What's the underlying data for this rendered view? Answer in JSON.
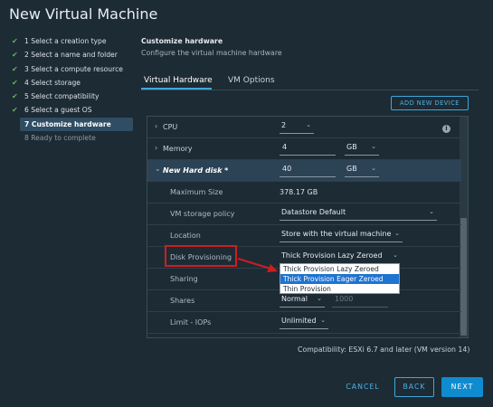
{
  "window": {
    "title": "New Virtual Machine"
  },
  "steps": [
    {
      "label": "1 Select a creation type",
      "state": "done"
    },
    {
      "label": "2 Select a name and folder",
      "state": "done"
    },
    {
      "label": "3 Select a compute resource",
      "state": "done"
    },
    {
      "label": "4 Select storage",
      "state": "done"
    },
    {
      "label": "5 Select compatibility",
      "state": "done"
    },
    {
      "label": "6 Select a guest OS",
      "state": "done"
    },
    {
      "label": "7 Customize hardware",
      "state": "active"
    },
    {
      "label": "8 Ready to complete",
      "state": "pending"
    }
  ],
  "header": {
    "title": "Customize hardware",
    "subtitle": "Configure the virtual machine hardware"
  },
  "tabs": [
    {
      "label": "Virtual Hardware",
      "active": true
    },
    {
      "label": "VM Options",
      "active": false
    }
  ],
  "add_device_label": "ADD NEW DEVICE",
  "hardware": {
    "cpu": {
      "label": "CPU",
      "value": "2"
    },
    "memory": {
      "label": "Memory",
      "value": "4",
      "unit": "GB"
    },
    "new_hard_disk": {
      "label": "New Hard disk *",
      "value": "40",
      "unit": "GB"
    },
    "maximum_size": {
      "label": "Maximum Size",
      "value": "378.17 GB"
    },
    "storage_policy": {
      "label": "VM storage policy",
      "value": "Datastore Default"
    },
    "location": {
      "label": "Location",
      "value": "Store with the virtual machine"
    },
    "disk_provisioning": {
      "label": "Disk Provisioning",
      "value": "Thick Provision Lazy Zeroed"
    },
    "sharing": {
      "label": "Sharing"
    },
    "shares": {
      "label": "Shares",
      "value": "Normal",
      "amount": "1000"
    },
    "limit_iops": {
      "label": "Limit - IOPs",
      "value": "Unlimited"
    }
  },
  "provisioning_options": [
    {
      "label": "Thick Provision Lazy Zeroed",
      "highlighted": false
    },
    {
      "label": "Thick Provision Eager Zeroed",
      "highlighted": true
    },
    {
      "label": "Thin Provision",
      "highlighted": false
    }
  ],
  "compatibility": "Compatibility: ESXi 6.7 and later (VM version 14)",
  "footer": {
    "cancel": "CANCEL",
    "back": "BACK",
    "next": "NEXT"
  },
  "colors": {
    "accent": "#3ea7dc",
    "primary_button": "#0f8bd0",
    "annotation": "#cc1f1f",
    "selection": "#1f73d1"
  },
  "icons": {
    "step_check": "check-icon",
    "expand": "chevron-right-icon",
    "collapse": "chevron-down-icon",
    "info": "info-icon"
  }
}
